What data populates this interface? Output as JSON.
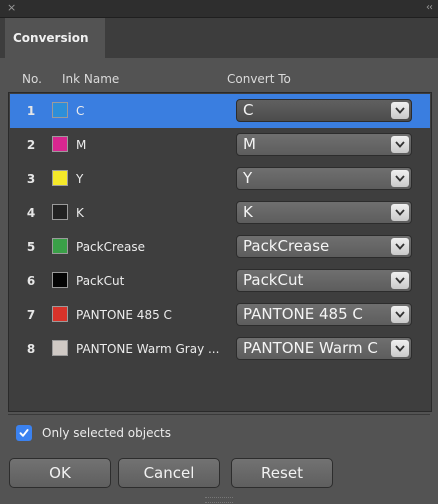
{
  "window": {
    "close_glyph": "×",
    "collapse_glyph": "‹‹"
  },
  "tab": {
    "label": "Conversion"
  },
  "columns": {
    "no": "No.",
    "ink_name": "Ink Name",
    "convert_to": "Convert To"
  },
  "rows": [
    {
      "num": "1",
      "ink": "C",
      "color": "#2d8fd9",
      "convert": "C"
    },
    {
      "num": "2",
      "ink": "M",
      "color": "#d7268f",
      "convert": "M"
    },
    {
      "num": "3",
      "ink": "Y",
      "color": "#f5e92a",
      "convert": "Y"
    },
    {
      "num": "4",
      "ink": "K",
      "color": "#222222",
      "convert": "K"
    },
    {
      "num": "5",
      "ink": "PackCrease",
      "color": "#3aa048",
      "convert": "PackCrease"
    },
    {
      "num": "6",
      "ink": "PackCut",
      "color": "#050505",
      "convert": "PackCut"
    },
    {
      "num": "7",
      "ink": "PANTONE 485 C",
      "color": "#d8332a",
      "convert": "PANTONE 485 C"
    },
    {
      "num": "8",
      "ink": "PANTONE Warm Gray ...",
      "color": "#cfc9c4",
      "convert": "PANTONE Warm C"
    }
  ],
  "selected_row": "1",
  "option": {
    "label": "Only selected objects",
    "checked": true
  },
  "buttons": {
    "ok": "OK",
    "cancel": "Cancel",
    "reset": "Reset"
  },
  "colors": {
    "accent": "#3a7ee0",
    "panel": "#535353"
  }
}
